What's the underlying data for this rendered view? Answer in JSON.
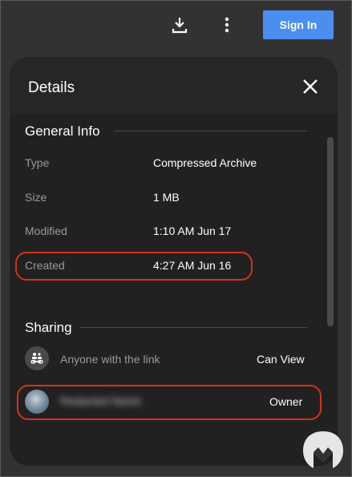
{
  "topbar": {
    "download_icon": "download-icon",
    "more_icon": "more-vertical-icon",
    "sign_in_label": "Sign In",
    "accent_color": "#4a8ff0"
  },
  "details": {
    "title": "Details",
    "close_icon": "close-icon",
    "general_info": {
      "heading": "General Info",
      "rows": [
        {
          "label": "Type",
          "value": "Compressed Archive"
        },
        {
          "label": "Size",
          "value": "1 MB"
        },
        {
          "label": "Modified",
          "value": "1:10 AM Jun 17"
        },
        {
          "label": "Created",
          "value": "4:27 AM Jun 16"
        }
      ]
    },
    "sharing": {
      "heading": "Sharing",
      "link_row": {
        "icon": "link-people-icon",
        "label": "Anyone with the link",
        "permission": "Can View"
      },
      "owner_row": {
        "name": "Redacted Name",
        "permission": "Owner"
      }
    }
  },
  "annotation_color": "#d6321a"
}
